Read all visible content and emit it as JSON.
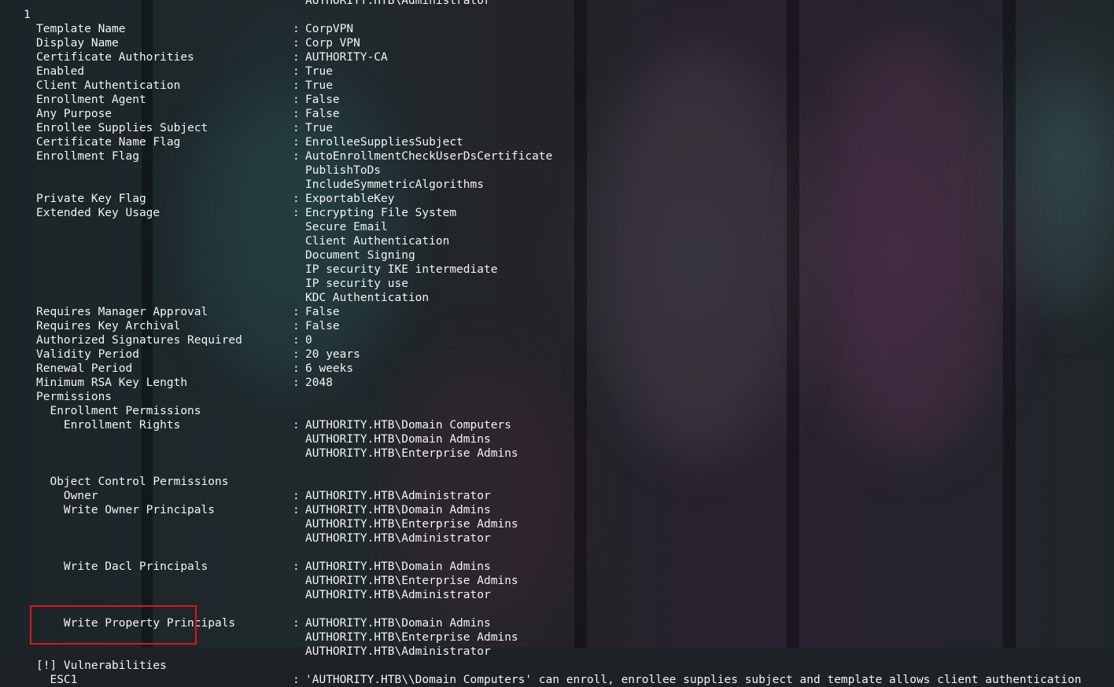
{
  "terminal": {
    "top_partial_value": "AUTHORITY.HTB\\Administrator",
    "index": "1",
    "rows": [
      {
        "label": "Template Name",
        "sep": ":",
        "value": "CorpVPN"
      },
      {
        "label": "Display Name",
        "sep": ":",
        "value": "Corp VPN"
      },
      {
        "label": "Certificate Authorities",
        "sep": ":",
        "value": "AUTHORITY-CA"
      },
      {
        "label": "Enabled",
        "sep": ":",
        "value": "True"
      },
      {
        "label": "Client Authentication",
        "sep": ":",
        "value": "True"
      },
      {
        "label": "Enrollment Agent",
        "sep": ":",
        "value": "False"
      },
      {
        "label": "Any Purpose",
        "sep": ":",
        "value": "False"
      },
      {
        "label": "Enrollee Supplies Subject",
        "sep": ":",
        "value": "True"
      },
      {
        "label": "Certificate Name Flag",
        "sep": ":",
        "value": "EnrolleeSuppliesSubject"
      },
      {
        "label": "Enrollment Flag",
        "sep": ":",
        "value": "AutoEnrollmentCheckUserDsCertificate"
      },
      {
        "label": "",
        "sep": "",
        "value": "PublishToDs"
      },
      {
        "label": "",
        "sep": "",
        "value": "IncludeSymmetricAlgorithms"
      },
      {
        "label": "Private Key Flag",
        "sep": ":",
        "value": "ExportableKey"
      },
      {
        "label": "Extended Key Usage",
        "sep": ":",
        "value": "Encrypting File System"
      },
      {
        "label": "",
        "sep": "",
        "value": "Secure Email"
      },
      {
        "label": "",
        "sep": "",
        "value": "Client Authentication"
      },
      {
        "label": "",
        "sep": "",
        "value": "Document Signing"
      },
      {
        "label": "",
        "sep": "",
        "value": "IP security IKE intermediate"
      },
      {
        "label": "",
        "sep": "",
        "value": "IP security use"
      },
      {
        "label": "",
        "sep": "",
        "value": "KDC Authentication"
      },
      {
        "label": "Requires Manager Approval",
        "sep": ":",
        "value": "False"
      },
      {
        "label": "Requires Key Archival",
        "sep": ":",
        "value": "False"
      },
      {
        "label": "Authorized Signatures Required",
        "sep": ":",
        "value": "0"
      },
      {
        "label": "Validity Period",
        "sep": ":",
        "value": "20 years"
      },
      {
        "label": "Renewal Period",
        "sep": ":",
        "value": "6 weeks"
      },
      {
        "label": "Minimum RSA Key Length",
        "sep": ":",
        "value": "2048"
      },
      {
        "label": "Permissions",
        "sep": "",
        "value": ""
      },
      {
        "label": "  Enrollment Permissions",
        "sep": "",
        "value": ""
      },
      {
        "label": "    Enrollment Rights",
        "sep": ":",
        "value": "AUTHORITY.HTB\\Domain Computers"
      },
      {
        "label": "",
        "sep": "",
        "value": "AUTHORITY.HTB\\Domain Admins"
      },
      {
        "label": "",
        "sep": "",
        "value": "AUTHORITY.HTB\\Enterprise Admins"
      },
      {
        "label": "",
        "sep": "",
        "value": ""
      },
      {
        "label": "  Object Control Permissions",
        "sep": "",
        "value": ""
      },
      {
        "label": "    Owner",
        "sep": ":",
        "value": "AUTHORITY.HTB\\Administrator"
      },
      {
        "label": "    Write Owner Principals",
        "sep": ":",
        "value": "AUTHORITY.HTB\\Domain Admins"
      },
      {
        "label": "",
        "sep": "",
        "value": "AUTHORITY.HTB\\Enterprise Admins"
      },
      {
        "label": "",
        "sep": "",
        "value": "AUTHORITY.HTB\\Administrator"
      },
      {
        "label": "",
        "sep": "",
        "value": ""
      },
      {
        "label": "    Write Dacl Principals",
        "sep": ":",
        "value": "AUTHORITY.HTB\\Domain Admins"
      },
      {
        "label": "",
        "sep": "",
        "value": "AUTHORITY.HTB\\Enterprise Admins"
      },
      {
        "label": "",
        "sep": "",
        "value": "AUTHORITY.HTB\\Administrator"
      },
      {
        "label": "",
        "sep": "",
        "value": ""
      },
      {
        "label": "    Write Property Principals",
        "sep": ":",
        "value": "AUTHORITY.HTB\\Domain Admins"
      },
      {
        "label": "",
        "sep": "",
        "value": "AUTHORITY.HTB\\Enterprise Admins"
      },
      {
        "label": "",
        "sep": "",
        "value": "AUTHORITY.HTB\\Administrator"
      },
      {
        "label": "[!] Vulnerabilities",
        "sep": "",
        "value": ""
      },
      {
        "label": "  ESC1",
        "sep": ":",
        "value": "'AUTHORITY.HTB\\\\Domain Computers' can enroll, enrollee supplies subject and template allows client authentication"
      }
    ]
  },
  "colors": {
    "text": "#f2f2f2",
    "highlight_border": "#e0141b",
    "background": "#1d2226"
  },
  "background_description_icon": "anime-wallpaper"
}
